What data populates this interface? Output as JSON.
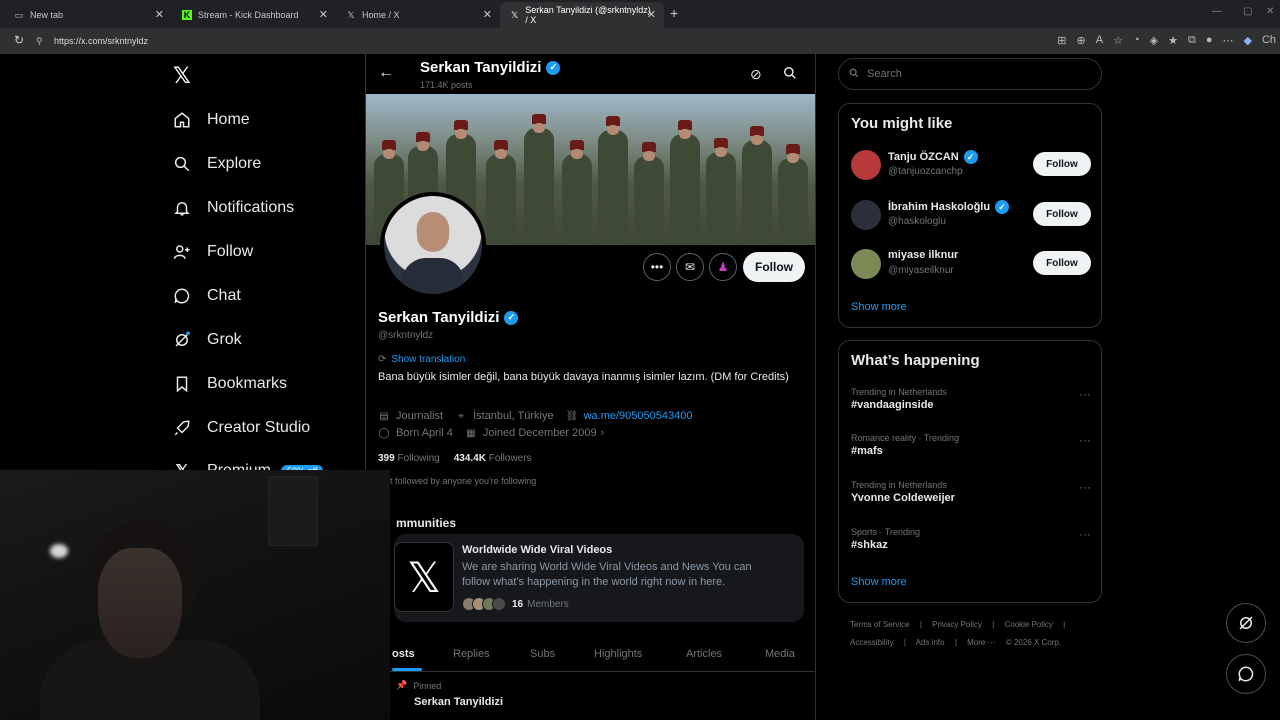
{
  "browser": {
    "tabs": [
      {
        "label": "New tab",
        "icon": "page-icon"
      },
      {
        "label": "Stream - Kick Dashboard",
        "icon": "kick-icon"
      },
      {
        "label": "Home / X",
        "icon": "x-icon"
      },
      {
        "label": "Serkan Tanyildizi (@srkntnyldz) / X",
        "icon": "x-icon"
      }
    ],
    "url": "https://x.com/srkntnyldz",
    "profile_chip": "Ch"
  },
  "nav": {
    "logo": "𝕏",
    "items": [
      {
        "label": "Home",
        "icon": "home-icon"
      },
      {
        "label": "Explore",
        "icon": "search-icon"
      },
      {
        "label": "Notifications",
        "icon": "bell-icon"
      },
      {
        "label": "Follow",
        "icon": "follow-icon"
      },
      {
        "label": "Chat",
        "icon": "chat-icon"
      },
      {
        "label": "Grok",
        "icon": "grok-icon"
      },
      {
        "label": "Bookmarks",
        "icon": "bookmark-icon"
      },
      {
        "label": "Creator Studio",
        "icon": "rocket-icon"
      },
      {
        "label": "Premium",
        "icon": "x-icon"
      }
    ],
    "premium_badge": "50% off"
  },
  "profile": {
    "header_name": "Serkan Tanyildizi",
    "posts_count": "171.4K posts",
    "name": "Serkan Tanyildizi",
    "handle": "@srkntnyldz",
    "follow_label": "Follow",
    "show_translation": "Show translation",
    "bio": "Bana büyük isimler değil, bana büyük davaya inanmış isimler lazım. (DM for Credits)",
    "job": "Journalist",
    "location": "İstanbul, Türkiye",
    "link": "wa.me/905050543400",
    "born": "Born April 4",
    "joined": "Joined December 2009",
    "following_count": "399",
    "following_label": "Following",
    "followers_count": "434.4K",
    "followers_label": "Followers",
    "followed_by": "t followed by anyone you're following",
    "communities_title": "mmunities",
    "community": {
      "name": "Worldwide Wide Viral Videos",
      "desc": "We are sharing World Wide Viral Videos and News You can follow what's happening in the world right now in here.",
      "members_count": "16",
      "members_label": "Members"
    },
    "tabs": [
      "osts",
      "Replies",
      "Subs",
      "Highlights",
      "Articles",
      "Media"
    ],
    "pinned_label": "Pinned",
    "tweet_name": "Serkan Tanyildizi"
  },
  "right": {
    "search_placeholder": "Search",
    "you_might_like": "You might like",
    "suggestions": [
      {
        "name": "Tanju ÖZCAN",
        "handle": "@tanjuozcanchp",
        "follow": "Follow",
        "avatar_color": "#b73a3a"
      },
      {
        "name": "İbrahim Haskoloğlu",
        "handle": "@haskologlu",
        "follow": "Follow",
        "avatar_color": "#2a2f3a"
      },
      {
        "name": "miyase ilknur",
        "handle": "@miyaseilknur",
        "follow": "Follow",
        "avatar_color": "#7b8a55"
      }
    ],
    "show_more_1": "Show more",
    "whats_happening": "What’s happening",
    "trends": [
      {
        "meta": "Trending in Netherlands",
        "title": "#vandaaginside"
      },
      {
        "meta": "Romance reality · Trending",
        "title": "#mafs"
      },
      {
        "meta": "Trending in Netherlands",
        "title": "Yvonne Coldeweijer"
      },
      {
        "meta": "Sports · Trending",
        "title": "#shkaz"
      }
    ],
    "show_more_2": "Show more",
    "footer_line1": [
      "Terms of Service",
      "|",
      "Privacy Policy",
      "|",
      "Cookie Policy",
      "|"
    ],
    "footer_line2": [
      "Accessibility",
      "|",
      "Ads info",
      "|",
      "More ···",
      "© 2026 X Corp."
    ]
  },
  "colors": {
    "accent": "#1d9bf0",
    "background": "#000000"
  }
}
